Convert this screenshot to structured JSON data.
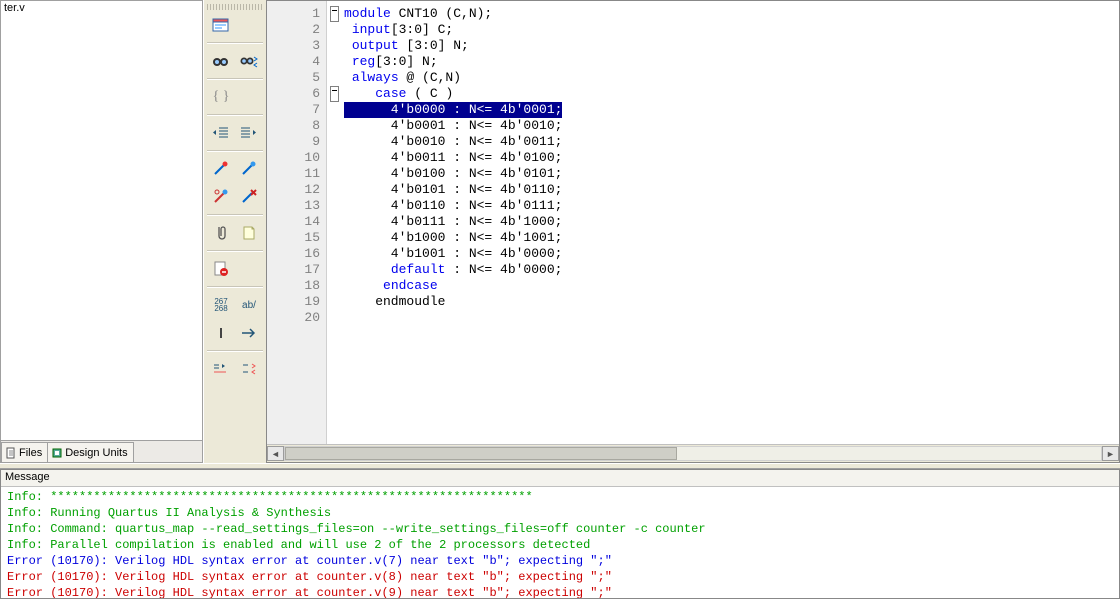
{
  "left_panel": {
    "file_name": "ter.v"
  },
  "tabs": {
    "files": "Files",
    "design_units": "Design Units"
  },
  "editor": {
    "lines": [
      {
        "n": 1,
        "html": "<span class='kw'>module</span> CNT10 (C,N);",
        "fold": "minus"
      },
      {
        "n": 2,
        "html": " <span class='kw'>input</span>[3:0] C;"
      },
      {
        "n": 3,
        "html": " <span class='kw'>output</span> [3:0] N;"
      },
      {
        "n": 4,
        "html": " <span class='kw'>reg</span>[3:0] N;"
      },
      {
        "n": 5,
        "html": " <span class='kw'>always</span> @ (C,N)"
      },
      {
        "n": 6,
        "html": "    <span class='kw'>case</span> ( C )",
        "fold": "minus"
      },
      {
        "n": 7,
        "html": "<span class='sel'>      4'b0000 : N<= 4b'0001;</span>"
      },
      {
        "n": 8,
        "html": "      4'b0001 : N<= 4b'0010;"
      },
      {
        "n": 9,
        "html": "      4'b0010 : N<= 4b'0011;"
      },
      {
        "n": 10,
        "html": "      4'b0011 : N<= 4b'0100;"
      },
      {
        "n": 11,
        "html": "      4'b0100 : N<= 4b'0101;"
      },
      {
        "n": 12,
        "html": "      4'b0101 : N<= 4b'0110;"
      },
      {
        "n": 13,
        "html": "      4'b0110 : N<= 4b'0111;"
      },
      {
        "n": 14,
        "html": "      4'b0111 : N<= 4b'1000;"
      },
      {
        "n": 15,
        "html": "      4'b1000 : N<= 4b'1001;"
      },
      {
        "n": 16,
        "html": "      4'b1001 : N<= 4b'0000;"
      },
      {
        "n": 17,
        "html": "      <span class='kw'>default</span> : N<= 4b'0000;"
      },
      {
        "n": 18,
        "html": "     <span class='kw'>endcase</span>"
      },
      {
        "n": 19,
        "html": "    endmoudle"
      },
      {
        "n": 20,
        "html": ""
      }
    ]
  },
  "messages": {
    "header": "Message",
    "rows": [
      {
        "cls": "info",
        "text": "Info: *******************************************************************"
      },
      {
        "cls": "info",
        "text": "Info: Running Quartus II Analysis & Synthesis"
      },
      {
        "cls": "info",
        "text": "Info: Command: quartus_map --read_settings_files=on --write_settings_files=off counter -c counter"
      },
      {
        "cls": "info",
        "text": "Info: Parallel compilation is enabled and will use 2 of the 2 processors detected"
      },
      {
        "cls": "err-blue",
        "text": "Error (10170): Verilog HDL syntax error at counter.v(7) near text \"b\";  expecting \";\""
      },
      {
        "cls": "err-red",
        "text": "Error (10170): Verilog HDL syntax error at counter.v(8) near text \"b\";  expecting \";\""
      },
      {
        "cls": "err-red",
        "text": "Error (10170): Verilog HDL syntax error at counter.v(9) near text \"b\";  expecting \";\""
      }
    ]
  },
  "toolbar_btns": {
    "row1a": "explorer",
    "row2a": "binoculars",
    "row2b": "binoculars-arrows",
    "row3a": "braces",
    "row4a": "indent-left",
    "row4b": "indent-right",
    "row5a": "wand-red",
    "row5b": "wand-blue",
    "row6a": "scissors",
    "row6b": "wand-x",
    "row7a": "clip",
    "row7b": "note",
    "row8a": "page-red",
    "row9a": "numbers",
    "row9b": "ab-slash",
    "row10a": "bar",
    "row10b": "arrow-right",
    "row11a": "step-in",
    "row11b": "step-swap"
  }
}
